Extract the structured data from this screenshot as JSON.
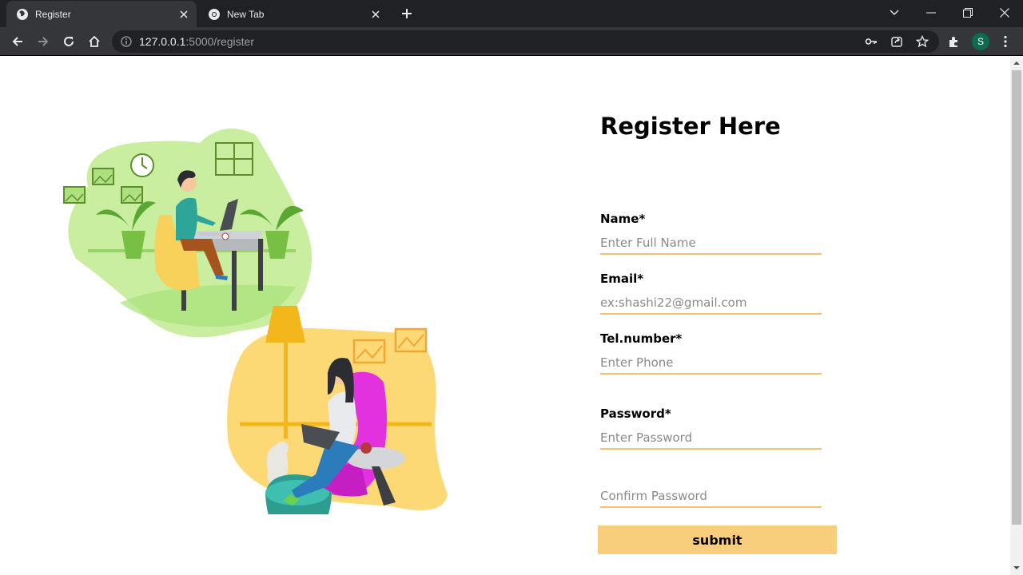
{
  "browser": {
    "tabs": [
      {
        "title": "Register",
        "active": true
      },
      {
        "title": "New Tab",
        "active": false
      }
    ],
    "url_host": "127.0.0.1",
    "url_path": ":5000/register",
    "profile_initial": "S"
  },
  "form": {
    "heading": "Register Here",
    "fields": [
      {
        "label": "Name*",
        "placeholder": "Enter Full Name"
      },
      {
        "label": "Email*",
        "placeholder": "ex:shashi22@gmail.com"
      },
      {
        "label": "Tel.number*",
        "placeholder": "Enter Phone"
      },
      {
        "label": "Password*",
        "placeholder": "Enter Password"
      },
      {
        "label": "",
        "placeholder": "Confirm Password"
      }
    ],
    "submit_label": "submit"
  },
  "colors": {
    "accent": "#f8ce7c",
    "underline": "#f0c374",
    "chrome_dark": "#202124",
    "chrome_mid": "#35363a"
  }
}
